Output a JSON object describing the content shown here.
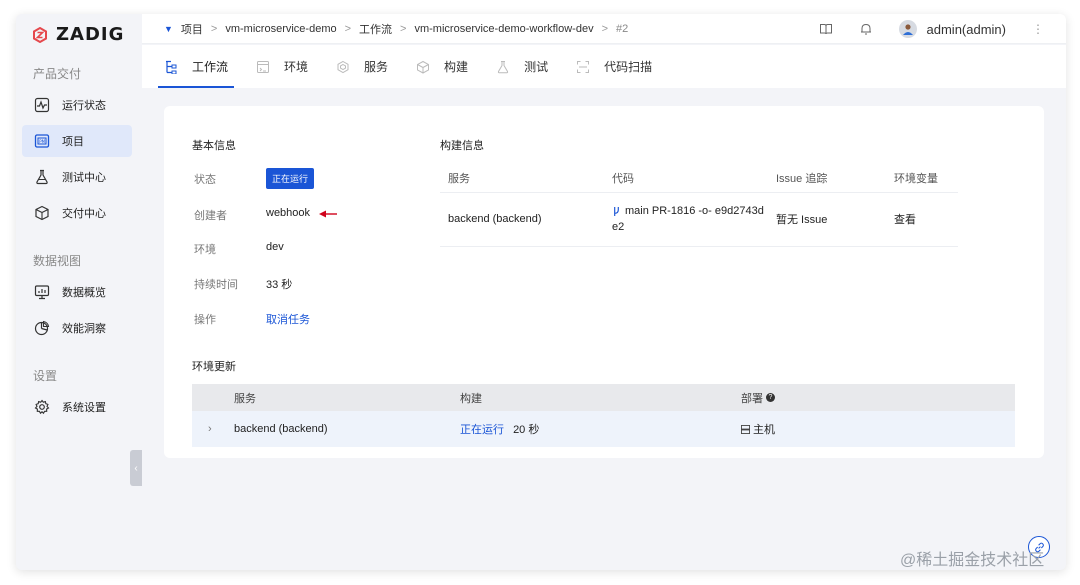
{
  "brand": {
    "name": "ZADIG",
    "accent": "#1a55d6",
    "logo_color": "#e5484d"
  },
  "sidebar": {
    "sections": [
      {
        "title": "产品交付"
      },
      {
        "title": "数据视图"
      },
      {
        "title": "设置"
      }
    ],
    "items": [
      {
        "label": "运行状态",
        "icon": "activity-icon"
      },
      {
        "label": "项目",
        "icon": "project-icon",
        "active": true
      },
      {
        "label": "测试中心",
        "icon": "flask-icon"
      },
      {
        "label": "交付中心",
        "icon": "package-icon"
      },
      {
        "label": "数据概览",
        "icon": "dashboard-icon"
      },
      {
        "label": "效能洞察",
        "icon": "pie-chart-icon"
      },
      {
        "label": "系统设置",
        "icon": "gear-icon"
      }
    ],
    "collapse_glyph": "‹"
  },
  "breadcrumb": {
    "caret": "▼",
    "items": [
      "项目",
      "vm-microservice-demo",
      "工作流",
      "vm-microservice-demo-workflow-dev",
      "#2"
    ],
    "separator": ">"
  },
  "user": {
    "name": "admin(admin)"
  },
  "tabs": [
    {
      "label": "工作流",
      "icon": "workflow-icon",
      "active": true
    },
    {
      "label": "环境",
      "icon": "environment-icon"
    },
    {
      "label": "服务",
      "icon": "service-icon"
    },
    {
      "label": "构建",
      "icon": "build-icon"
    },
    {
      "label": "测试",
      "icon": "test-icon"
    },
    {
      "label": "代码扫描",
      "icon": "scan-icon"
    }
  ],
  "basic_info": {
    "title": "基本信息",
    "status_label": "状态",
    "status_value": "正在运行",
    "creator_label": "创建者",
    "creator_value": "webhook",
    "env_label": "环境",
    "env_value": "dev",
    "duration_label": "持续时间",
    "duration_value": "33 秒",
    "action_label": "操作",
    "action_value": "取消任务"
  },
  "build_info": {
    "title": "构建信息",
    "headers": [
      "服务",
      "代码",
      "Issue 追踪",
      "环境变量"
    ],
    "row": {
      "service": "backend (backend)",
      "code_line1": "main PR-1816  -o- e9d2743d",
      "code_line2": "e2",
      "issue": "暂无 Issue",
      "env": "查看"
    }
  },
  "env_update": {
    "title": "环境更新",
    "headers": [
      "服务",
      "构建",
      "部署"
    ],
    "row": {
      "chevron": "›",
      "service": "backend (backend)",
      "build_status": "正在运行",
      "build_time": "20 秒",
      "deploy": "主机"
    }
  },
  "watermark": "@稀土掘金技术社区"
}
